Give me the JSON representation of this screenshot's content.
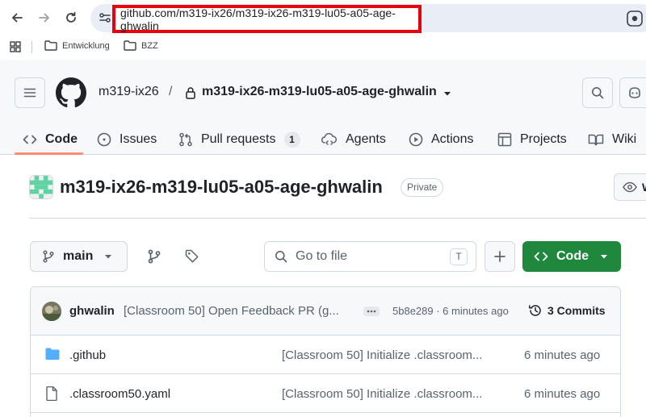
{
  "browser": {
    "url": "github.com/m319-ix26/m319-ix26-m319-lu05-a05-age-ghwalin",
    "bookmarks": [
      "Entwicklung",
      "BZZ"
    ]
  },
  "header": {
    "owner": "m319-ix26",
    "separator": "/",
    "repo": "m319-ix26-m319-lu05-a05-age-ghwalin"
  },
  "tabs": [
    {
      "label": "Code",
      "icon": "code-icon",
      "active": true
    },
    {
      "label": "Issues",
      "icon": "issue-opened-icon"
    },
    {
      "label": "Pull requests",
      "icon": "git-pull-request-icon",
      "count": "1"
    },
    {
      "label": "Agents",
      "icon": "agent-icon"
    },
    {
      "label": "Actions",
      "icon": "play-icon"
    },
    {
      "label": "Projects",
      "icon": "table-icon"
    },
    {
      "label": "Wiki",
      "icon": "book-icon"
    }
  ],
  "repo": {
    "title": "m319-ix26-m319-lu05-a05-age-ghwalin",
    "visibility": "Private",
    "watch_label": "W"
  },
  "toolbar": {
    "branch": "main",
    "goto_placeholder": "Go to file",
    "goto_shortcut": "T",
    "code_label": "Code"
  },
  "latest_commit": {
    "author": "ghwalin",
    "message": "[Classroom 50] Open Feedback PR (g...",
    "sha_time": "5b8e289 · 6 minutes ago",
    "commits_label": "3 Commits"
  },
  "files": [
    {
      "type": "folder",
      "name": ".github",
      "message": "[Classroom 50] Initialize .classroom...",
      "time": "6 minutes ago"
    },
    {
      "type": "file",
      "name": ".classroom50.yaml",
      "message": "[Classroom 50] Initialize .classroom...",
      "time": "6 minutes ago"
    }
  ],
  "colors": {
    "url_highlight": "#e8000b",
    "active_tab_underline": "#fd8c73",
    "code_button": "#1f883d",
    "folder": "#54aeff"
  }
}
